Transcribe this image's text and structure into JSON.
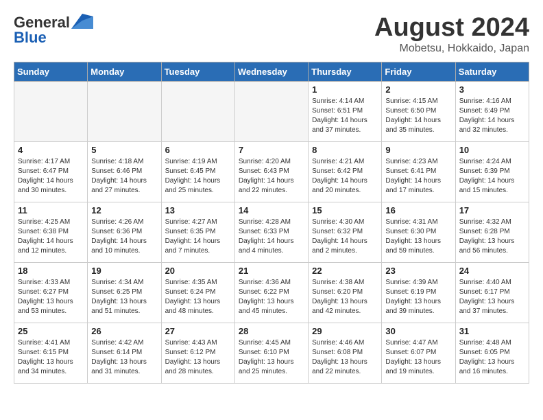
{
  "header": {
    "logo_general": "General",
    "logo_blue": "Blue",
    "month_title": "August 2024",
    "location": "Mobetsu, Hokkaido, Japan"
  },
  "days_of_week": [
    "Sunday",
    "Monday",
    "Tuesday",
    "Wednesday",
    "Thursday",
    "Friday",
    "Saturday"
  ],
  "weeks": [
    [
      {
        "num": "",
        "info": ""
      },
      {
        "num": "",
        "info": ""
      },
      {
        "num": "",
        "info": ""
      },
      {
        "num": "",
        "info": ""
      },
      {
        "num": "1",
        "info": "Sunrise: 4:14 AM\nSunset: 6:51 PM\nDaylight: 14 hours and 37 minutes."
      },
      {
        "num": "2",
        "info": "Sunrise: 4:15 AM\nSunset: 6:50 PM\nDaylight: 14 hours and 35 minutes."
      },
      {
        "num": "3",
        "info": "Sunrise: 4:16 AM\nSunset: 6:49 PM\nDaylight: 14 hours and 32 minutes."
      }
    ],
    [
      {
        "num": "4",
        "info": "Sunrise: 4:17 AM\nSunset: 6:47 PM\nDaylight: 14 hours and 30 minutes."
      },
      {
        "num": "5",
        "info": "Sunrise: 4:18 AM\nSunset: 6:46 PM\nDaylight: 14 hours and 27 minutes."
      },
      {
        "num": "6",
        "info": "Sunrise: 4:19 AM\nSunset: 6:45 PM\nDaylight: 14 hours and 25 minutes."
      },
      {
        "num": "7",
        "info": "Sunrise: 4:20 AM\nSunset: 6:43 PM\nDaylight: 14 hours and 22 minutes."
      },
      {
        "num": "8",
        "info": "Sunrise: 4:21 AM\nSunset: 6:42 PM\nDaylight: 14 hours and 20 minutes."
      },
      {
        "num": "9",
        "info": "Sunrise: 4:23 AM\nSunset: 6:41 PM\nDaylight: 14 hours and 17 minutes."
      },
      {
        "num": "10",
        "info": "Sunrise: 4:24 AM\nSunset: 6:39 PM\nDaylight: 14 hours and 15 minutes."
      }
    ],
    [
      {
        "num": "11",
        "info": "Sunrise: 4:25 AM\nSunset: 6:38 PM\nDaylight: 14 hours and 12 minutes."
      },
      {
        "num": "12",
        "info": "Sunrise: 4:26 AM\nSunset: 6:36 PM\nDaylight: 14 hours and 10 minutes."
      },
      {
        "num": "13",
        "info": "Sunrise: 4:27 AM\nSunset: 6:35 PM\nDaylight: 14 hours and 7 minutes."
      },
      {
        "num": "14",
        "info": "Sunrise: 4:28 AM\nSunset: 6:33 PM\nDaylight: 14 hours and 4 minutes."
      },
      {
        "num": "15",
        "info": "Sunrise: 4:30 AM\nSunset: 6:32 PM\nDaylight: 14 hours and 2 minutes."
      },
      {
        "num": "16",
        "info": "Sunrise: 4:31 AM\nSunset: 6:30 PM\nDaylight: 13 hours and 59 minutes."
      },
      {
        "num": "17",
        "info": "Sunrise: 4:32 AM\nSunset: 6:28 PM\nDaylight: 13 hours and 56 minutes."
      }
    ],
    [
      {
        "num": "18",
        "info": "Sunrise: 4:33 AM\nSunset: 6:27 PM\nDaylight: 13 hours and 53 minutes."
      },
      {
        "num": "19",
        "info": "Sunrise: 4:34 AM\nSunset: 6:25 PM\nDaylight: 13 hours and 51 minutes."
      },
      {
        "num": "20",
        "info": "Sunrise: 4:35 AM\nSunset: 6:24 PM\nDaylight: 13 hours and 48 minutes."
      },
      {
        "num": "21",
        "info": "Sunrise: 4:36 AM\nSunset: 6:22 PM\nDaylight: 13 hours and 45 minutes."
      },
      {
        "num": "22",
        "info": "Sunrise: 4:38 AM\nSunset: 6:20 PM\nDaylight: 13 hours and 42 minutes."
      },
      {
        "num": "23",
        "info": "Sunrise: 4:39 AM\nSunset: 6:19 PM\nDaylight: 13 hours and 39 minutes."
      },
      {
        "num": "24",
        "info": "Sunrise: 4:40 AM\nSunset: 6:17 PM\nDaylight: 13 hours and 37 minutes."
      }
    ],
    [
      {
        "num": "25",
        "info": "Sunrise: 4:41 AM\nSunset: 6:15 PM\nDaylight: 13 hours and 34 minutes."
      },
      {
        "num": "26",
        "info": "Sunrise: 4:42 AM\nSunset: 6:14 PM\nDaylight: 13 hours and 31 minutes."
      },
      {
        "num": "27",
        "info": "Sunrise: 4:43 AM\nSunset: 6:12 PM\nDaylight: 13 hours and 28 minutes."
      },
      {
        "num": "28",
        "info": "Sunrise: 4:45 AM\nSunset: 6:10 PM\nDaylight: 13 hours and 25 minutes."
      },
      {
        "num": "29",
        "info": "Sunrise: 4:46 AM\nSunset: 6:08 PM\nDaylight: 13 hours and 22 minutes."
      },
      {
        "num": "30",
        "info": "Sunrise: 4:47 AM\nSunset: 6:07 PM\nDaylight: 13 hours and 19 minutes."
      },
      {
        "num": "31",
        "info": "Sunrise: 4:48 AM\nSunset: 6:05 PM\nDaylight: 13 hours and 16 minutes."
      }
    ]
  ]
}
